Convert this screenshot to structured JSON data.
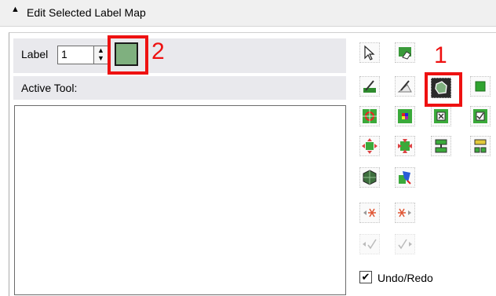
{
  "header": {
    "title": "Edit Selected Label Map",
    "collapse_icon": "triangle-up-icon"
  },
  "label_row": {
    "label_text": "Label",
    "value": "1",
    "swatch_color": "#7fb07f"
  },
  "active_tool": {
    "label": "Active Tool:"
  },
  "annotations": {
    "callout_1": "1",
    "callout_2": "2",
    "callout_color": "#e11111"
  },
  "tools": [
    "pointer-icon",
    "eraser-icon",
    "paint-brush-icon",
    "threshold-brush-icon",
    "fill-label-icon",
    "square-icon",
    "seed-grow-icon",
    "multi-color-icon",
    "remove-island-icon",
    "keep-island-icon",
    "dilate-icon",
    "erode-icon",
    "merge-icon",
    "split-icon",
    "mesh-icon",
    "morph-icon",
    "prev-slice-icon",
    "next-slice-icon",
    "undo-check-icon",
    "redo-check-icon"
  ],
  "undo_redo": {
    "label": "Undo/Redo",
    "checked": true
  }
}
